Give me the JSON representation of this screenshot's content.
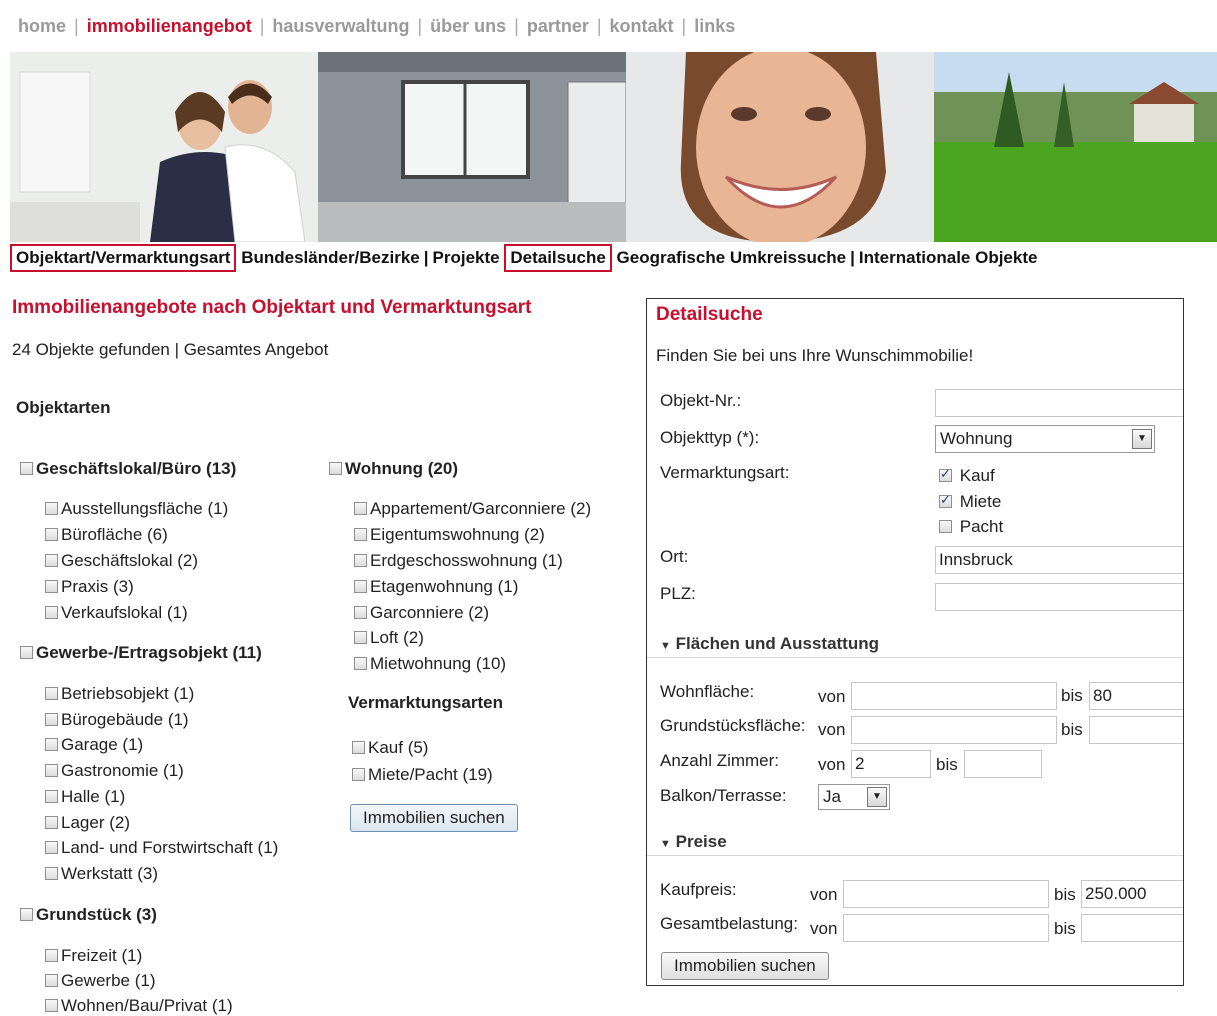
{
  "topnav": {
    "items": [
      "home",
      "immobilienangebot",
      "hausverwaltung",
      "über uns",
      "partner",
      "kontakt",
      "links"
    ]
  },
  "subnav": {
    "items": [
      "Objektart/Vermarktungsart",
      "Bundesländer/Bezirke",
      "Projekte",
      "Detailsuche",
      "Geografische Umkreissuche",
      "Internationale Objekte"
    ]
  },
  "main": {
    "title": "Immobilienangebote nach Objektart und Vermarktungsart",
    "result_count": "24 Objekte gefunden | Gesamtes Angebot",
    "objektarten_heading": "Objektarten",
    "cat1": {
      "label": "Geschäftslokal/Büro (13)",
      "items": [
        "Ausstellungsfläche (1)",
        "Bürofläche (6)",
        "Geschäftslokal (2)",
        "Praxis (3)",
        "Verkaufslokal (1)"
      ]
    },
    "cat2": {
      "label": "Gewerbe-/Ertragsobjekt (11)",
      "items": [
        "Betriebsobjekt (1)",
        "Bürogebäude (1)",
        "Garage (1)",
        "Gastronomie (1)",
        "Halle (1)",
        "Lager (2)",
        "Land- und Forstwirtschaft (1)",
        "Werkstatt (3)"
      ]
    },
    "cat3": {
      "label": "Grundstück (3)",
      "items": [
        "Freizeit (1)",
        "Gewerbe (1)",
        "Wohnen/Bau/Privat (1)"
      ]
    },
    "cat4": {
      "label": "Wohnung (20)",
      "items": [
        "Appartement/Garconniere (2)",
        "Eigentumswohnung (2)",
        "Erdgeschosswohnung (1)",
        "Etagenwohnung (1)",
        "Garconniere (2)",
        "Loft (2)",
        "Mietwohnung (10)"
      ]
    },
    "vermarktung_heading": "Vermarktungsarten",
    "vermarktung_items": [
      "Kauf (5)",
      "Miete/Pacht (19)"
    ],
    "search_button": "Immobilien suchen"
  },
  "detail": {
    "title": "Detailsuche",
    "intro": "Finden Sie bei uns Ihre Wunschimmobilie!",
    "objektnr_label": "Objekt-Nr.:",
    "objektnr_value": "",
    "objekttyp_label": "Objekttyp (*):",
    "objekttyp_value": "Wohnung",
    "vermarktungsart_label": "Vermarktungsart:",
    "vermarktungsart_options": [
      {
        "label": "Kauf",
        "checked": true
      },
      {
        "label": "Miete",
        "checked": true
      },
      {
        "label": "Pacht",
        "checked": false
      }
    ],
    "ort_label": "Ort:",
    "ort_value": "Innsbruck",
    "plz_label": "PLZ:",
    "plz_value": "",
    "section_flaechen": "Flächen und Ausstattung",
    "wohnflaeche_label": "Wohnfläche:",
    "grundstueck_label": "Grundstücksfläche:",
    "zimmer_label": "Anzahl Zimmer:",
    "balkon_label": "Balkon/Terrasse:",
    "von": "von",
    "bis": "bis",
    "wohnflaeche_von": "",
    "wohnflaeche_bis": "80",
    "grundstueck_von": "",
    "grundstueck_bis": "",
    "zimmer_von": "2",
    "zimmer_bis": "",
    "balkon_value": "Ja",
    "section_preise": "Preise",
    "kaufpreis_label": "Kaufpreis:",
    "gesamtbelastung_label": "Gesamtbelastung:",
    "kaufpreis_von": "",
    "kaufpreis_bis": "250.000",
    "gesamtbelastung_von": "",
    "gesamtbelastung_bis": "",
    "search_button": "Immobilien suchen"
  },
  "colors": {
    "accent": "#c8102e",
    "nav_gray": "#9a9a9a"
  }
}
